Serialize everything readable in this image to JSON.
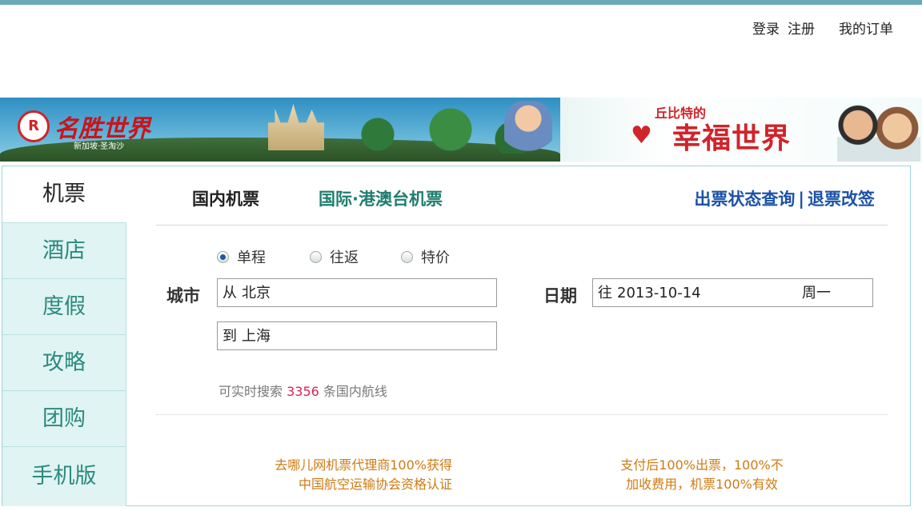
{
  "header": {
    "login": "登录",
    "register": "注册",
    "my_orders": "我的订单"
  },
  "banner": {
    "logo_mark": "R",
    "logo_text": "名胜世界",
    "logo_sub": "新加坡·圣淘沙",
    "promo_small": "丘比特的",
    "promo_big": "幸福世界"
  },
  "sidebar": {
    "items": [
      {
        "label": "机票"
      },
      {
        "label": "酒店"
      },
      {
        "label": "度假"
      },
      {
        "label": "攻略"
      },
      {
        "label": "团购"
      },
      {
        "label": "手机版"
      }
    ],
    "active_index": 0
  },
  "tabs": {
    "domestic": "国内机票",
    "international": "国际·港澳台机票"
  },
  "links": {
    "status_query": "出票状态查询",
    "separator": "|",
    "refund_change": "退票改签"
  },
  "trip_type": {
    "options": [
      "单程",
      "往返",
      "特价"
    ],
    "selected": "单程"
  },
  "form": {
    "city_label": "城市",
    "from_prefix": "从",
    "from_value": "北京",
    "to_prefix": "到",
    "to_value": "上海",
    "date_label": "日期",
    "date_prefix": "往",
    "date_value": "2013-10-14",
    "weekday": "周一"
  },
  "search_info": {
    "prefix": "可实时搜索",
    "count": "3356",
    "suffix": "条国内航线"
  },
  "promos": {
    "left_line1": "去哪儿网机票代理商100%获得",
    "left_line2": "中国航空运输协会资格认证",
    "right_line1": "支付后100%出票，100%不",
    "right_line2": "加收费用，机票100%有效"
  },
  "colors": {
    "accent_teal": "#2b8a7f",
    "link_blue": "#1b52a8",
    "highlight_pink": "#e01e5a",
    "promo_orange": "#cf7a12"
  }
}
